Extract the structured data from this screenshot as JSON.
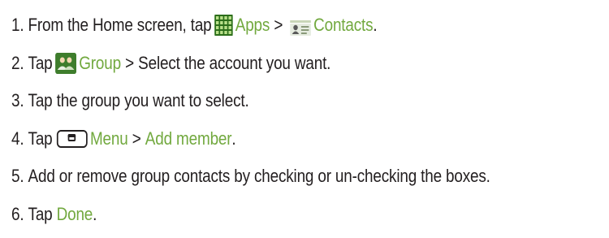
{
  "steps": [
    {
      "num": "1.",
      "lead": "From the Home screen, tap",
      "apps_label": "Apps",
      "separator": ">",
      "contacts_label": "Contacts",
      "end": "."
    },
    {
      "num": "2.",
      "lead": "Tap",
      "group_label": "Group",
      "separator": ">",
      "tail": "Select the account you want."
    },
    {
      "num": "3.",
      "text": "Tap the group you want to select."
    },
    {
      "num": "4.",
      "lead": "Tap",
      "menu_label": "Menu",
      "separator": ">",
      "add_member_label": "Add member",
      "end": "."
    },
    {
      "num": "5.",
      "text": "Add or remove group contacts by checking or un-checking the boxes."
    },
    {
      "num": "6.",
      "lead": "Tap",
      "done_label": "Done",
      "end": "."
    }
  ],
  "icons": {
    "apps": "apps-grid-icon",
    "contacts": "contacts-icon",
    "group": "group-icon",
    "menu": "menu-key-icon"
  },
  "colors": {
    "text": "#231f20",
    "highlight": "#72a93f",
    "icon_green": "#2f7d1f"
  }
}
